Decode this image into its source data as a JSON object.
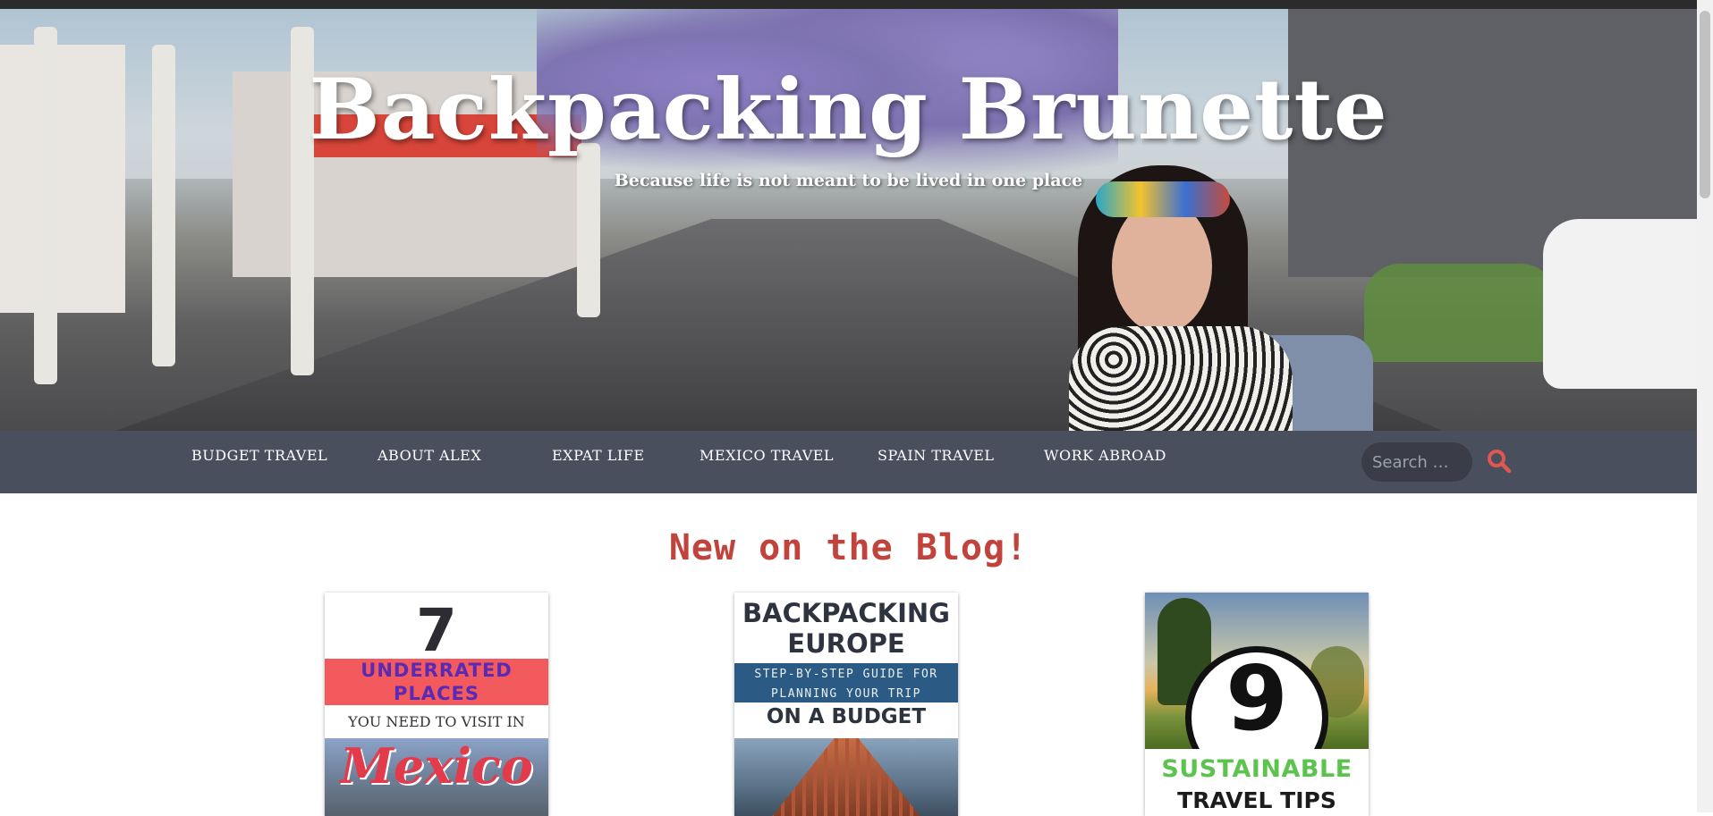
{
  "site": {
    "title": "Backpacking Brunette",
    "tagline": "Because life is not meant to be lived in one place"
  },
  "nav": {
    "items": [
      {
        "label": "BUDGET TRAVEL"
      },
      {
        "label": "ABOUT ALEX"
      },
      {
        "label": "EXPAT LIFE"
      },
      {
        "label": "MEXICO TRAVEL"
      },
      {
        "label": "SPAIN TRAVEL"
      },
      {
        "label": "WORK ABROAD"
      }
    ],
    "search_placeholder": "Search …",
    "search_icon": "magnifier-icon",
    "bar_color": "#4a4f5e",
    "accent_color": "#e0574f"
  },
  "section": {
    "heading": "New on the Blog!",
    "heading_color": "#c0443c"
  },
  "posts": [
    {
      "number": "7",
      "line1": "UNDERRATED",
      "line2": "PLACES",
      "line3": "YOU NEED TO VISIT IN",
      "script": "Mexico"
    },
    {
      "line1": "BACKPACKING",
      "line2": "EUROPE",
      "sub1": "STEP-BY-STEP GUIDE FOR",
      "sub2": "PLANNING YOUR TRIP",
      "line3": "ON A BUDGET"
    },
    {
      "number": "9",
      "line1": "SUSTAINABLE",
      "line2": "TRAVEL TIPS"
    }
  ]
}
